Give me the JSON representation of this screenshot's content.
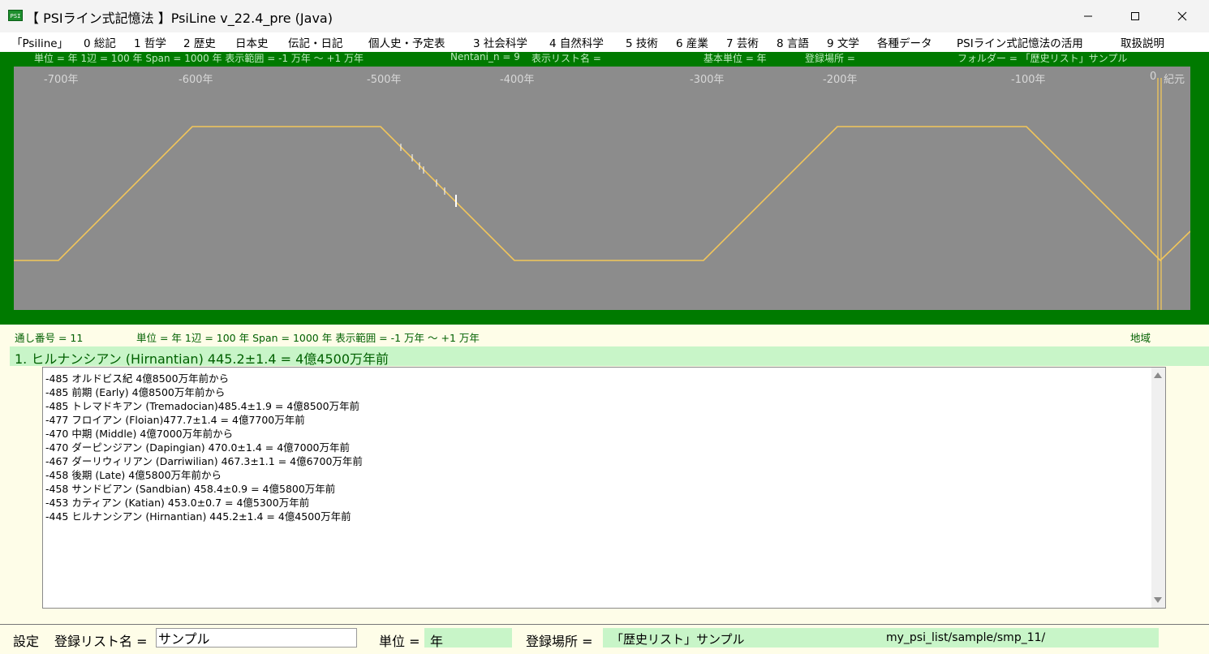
{
  "window": {
    "app_icon_label": "PSI",
    "title": "【 PSIライン式記憶法 】PsiLine v_22.4_pre (Java)"
  },
  "menu": [
    "「Psiline」",
    "0 総記",
    "1 哲学",
    "2 歴史",
    "日本史",
    "伝記・日記",
    "個人史・予定表",
    "3 社会科学",
    "4 自然科学",
    "5 技術",
    "6 産業",
    "7 芸術",
    "8 言語",
    "9 文学",
    "各種データ",
    "PSIライン式記憶法の活用",
    "取扱説明"
  ],
  "top_status": {
    "unit_span": "単位 = 年  1辺 = 100 年  Span = 1000 年  表示範囲 = -1 万年 〜 +1 万年",
    "nentani": "Nentani_n = 9",
    "list_name": "表示リスト名 =",
    "base_unit": "基本単位 = 年",
    "location": "登録場所 =",
    "folder": "フォルダー = 「歴史リスト」サンプル"
  },
  "timeline": {
    "axis_ticks": [
      "-700年",
      "-600年",
      "-500年",
      "-400年",
      "-300年",
      "-200年",
      "-100年",
      "0",
      "紀元"
    ],
    "colors": {
      "panel": "#007a00",
      "plot": "#8c8c8c",
      "line": "#f2c65a",
      "marker": "#ffffff"
    }
  },
  "info_bar": {
    "serial": "通し番号 = 11",
    "unit_span": "単位 = 年  1辺 = 100 年  Span = 1000 年  表示範囲 = -1 万年 〜 +1 万年",
    "region": "地域"
  },
  "heading": "1. ヒルナンシアン (Hirnantian) 445.2±1.4 = 4億4500万年前",
  "list": [
    "-485  オルドビス紀 4億8500万年前から",
    "-485  前期 (Early) 4億8500万年前から",
    "-485  トレマドキアン (Tremadocian)485.4±1.9 = 4億8500万年前",
    "-477  フロイアン (Floian)477.7±1.4 = 4億7700万年前",
    "-470  中期 (Middle) 4億7000万年前から",
    "-470  ダーピンジアン (Dapingian) 470.0±1.4 = 4億7000万年前",
    "-467  ダーリウィリアン (Darriwilian) 467.3±1.1 = 4億6700万年前",
    "-458  後期 (Late) 4億5800万年前から",
    "-458  サンドビアン (Sandbian) 458.4±0.9 = 4億5800万年前",
    "-453  カティアン (Katian) 453.0±0.7 = 4億5300万年前",
    "-445  ヒルナンシアン (Hirnantian) 445.2±1.4 = 4億4500万年前"
  ],
  "footer": {
    "settings": "設定",
    "list_name_label": "登録リスト名 =",
    "list_name_value": "サンプル",
    "unit_label": "単位 =",
    "unit_value": "年",
    "location_label": "登録場所 =",
    "location_value": "「歴史リスト」サンプル",
    "path": "my_psi_list/sample/smp_11/"
  }
}
